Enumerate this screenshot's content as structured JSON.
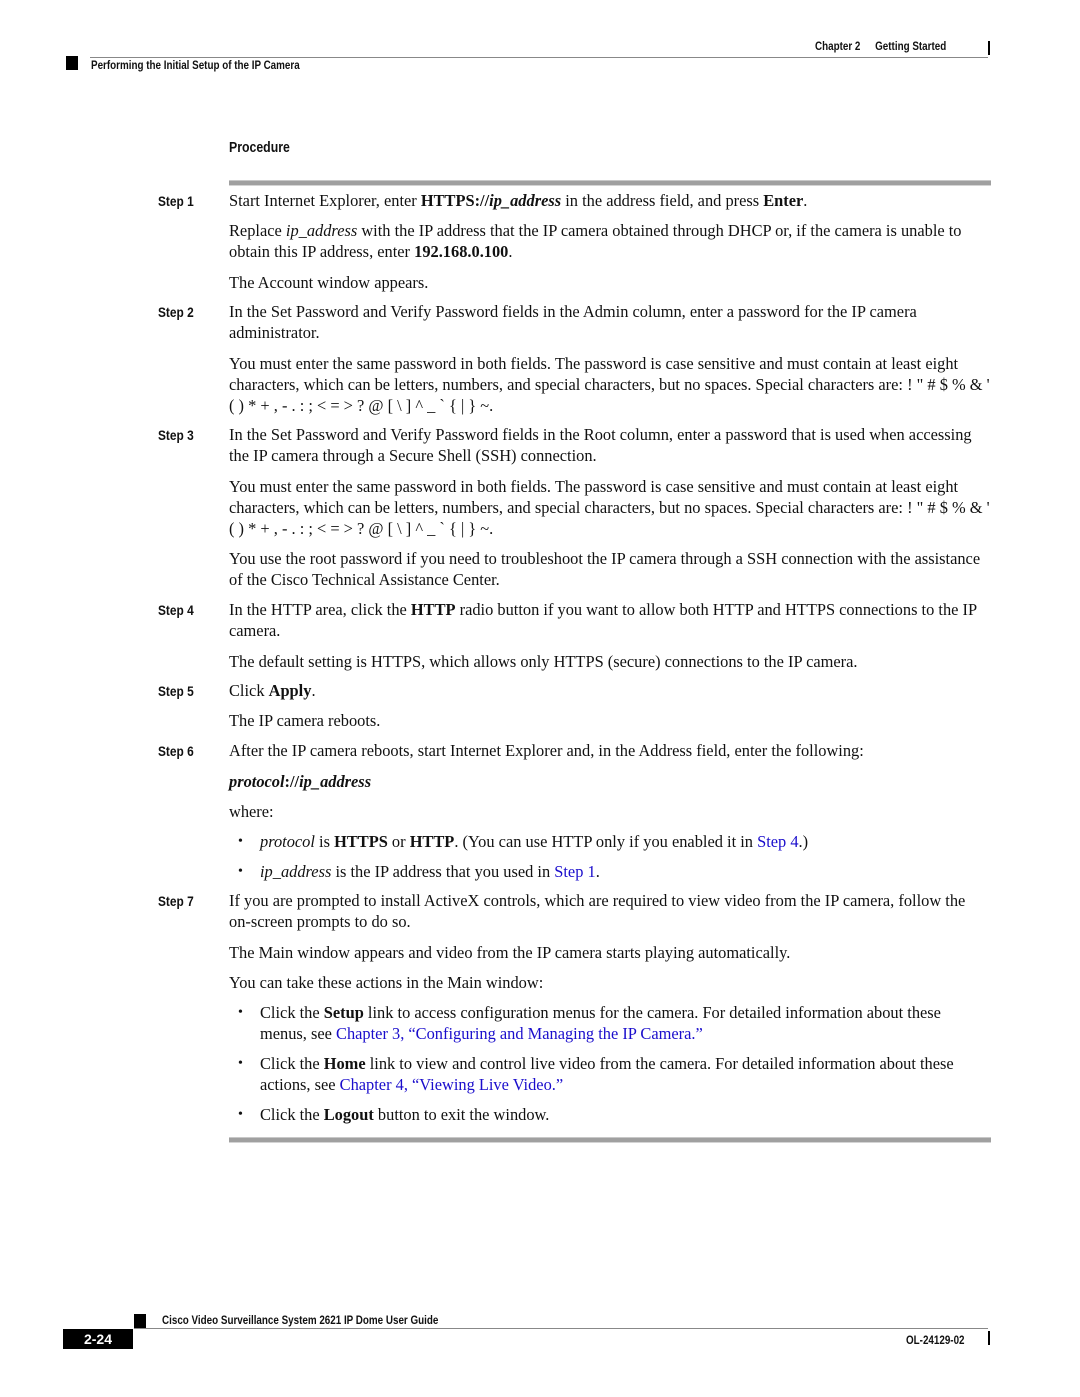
{
  "header": {
    "chapter": "Chapter 2",
    "chapter_title": "Getting Started",
    "section": "Performing the Initial Setup of the IP Camera"
  },
  "procedure": {
    "heading": "Procedure",
    "steps": [
      {
        "label": "Step 1",
        "p1": {
          "a": "Start Internet Explorer, enter ",
          "b": "HTTPS://",
          "c": "ip_address",
          "d": " in the address field, and press ",
          "e": "Enter",
          "f": "."
        },
        "p2": {
          "a": "Replace ",
          "b": "ip_address",
          "c": " with the IP address that the IP camera obtained through DHCP or, if the camera is unable to obtain this IP address, enter ",
          "d": "192.168.0.100",
          "e": "."
        },
        "p3": "The Account window appears."
      },
      {
        "label": "Step 2",
        "p1": "In the Set Password and Verify Password fields in the Admin column, enter a password for the IP camera administrator.",
        "p2": "You must enter the same password in both fields. The password is case sensitive and must contain at least eight characters, which can be letters, numbers, and special characters, but no spaces. Special characters are: ! \" # $ % & ' ( ) * + , - . : ; < = > ? @ [ \\ ] ^ _ ` { | } ~."
      },
      {
        "label": "Step 3",
        "p1": "In the Set Password and Verify Password fields in the Root column, enter a password that is used when accessing the IP camera through a Secure Shell (SSH) connection.",
        "p2": "You must enter the same password in both fields. The password is case sensitive and must contain at least eight characters, which can be letters, numbers, and special characters, but no spaces. Special characters are: ! \" # $ % & ' ( ) * + , - . : ; < = > ? @ [ \\ ] ^ _ ` { | } ~.",
        "p3": "You use the root password if you need to troubleshoot the IP camera through a SSH connection with the assistance of the Cisco Technical Assistance Center."
      },
      {
        "label": "Step 4",
        "p1": {
          "a": "In the HTTP area, click the ",
          "b": "HTTP",
          "c": " radio button if you want to allow both HTTP and HTTPS connections to the IP camera."
        },
        "p2": "The default setting is HTTPS, which allows only HTTPS (secure) connections to the IP camera."
      },
      {
        "label": "Step 5",
        "p1": {
          "a": "Click ",
          "b": "Apply",
          "c": "."
        },
        "p2": "The IP camera reboots."
      },
      {
        "label": "Step 6",
        "p1": "After the IP camera reboots, start Internet Explorer and, in the Address field, enter the following:",
        "code": {
          "a": "protocol",
          "b": "://",
          "c": "ip_address"
        },
        "where": "where:",
        "bullets": [
          {
            "a": "protocol",
            "b": " is ",
            "c": "HTTPS",
            "d": " or ",
            "e": "HTTP",
            "f": ". (You can use HTTP only if you enabled it in ",
            "link": "Step 4",
            "g": ".)"
          },
          {
            "a": "ip_address",
            "b": " is the IP address that you used in ",
            "link": "Step 1",
            "c": "."
          }
        ]
      },
      {
        "label": "Step 7",
        "p1": "If you are prompted to install ActiveX controls, which are required to view video from the IP camera, follow the on-screen prompts to do so.",
        "p2": "The Main window appears and video from the IP camera starts playing automatically.",
        "p3": "You can take these actions in the Main window:",
        "bullets": [
          {
            "a": "Click the ",
            "b": "Setup",
            "c": " link to access configuration menus for the camera. For detailed information about these menus, see ",
            "link": "Chapter 3, “Configuring and Managing the IP Camera.”"
          },
          {
            "a": "Click the ",
            "b": "Home",
            "c": " link to view and control live video from the camera. For detailed information about these actions, see ",
            "link": "Chapter 4, “Viewing Live Video.”"
          },
          {
            "a": "Click the ",
            "b": "Logout",
            "c": " button to exit the window."
          }
        ]
      }
    ],
    "bullet_glyph": "•"
  },
  "footer": {
    "guide_title": "Cisco Video Surveillance System 2621 IP Dome User Guide",
    "page_number": "2-24",
    "doc_number": "OL-24129-02"
  }
}
